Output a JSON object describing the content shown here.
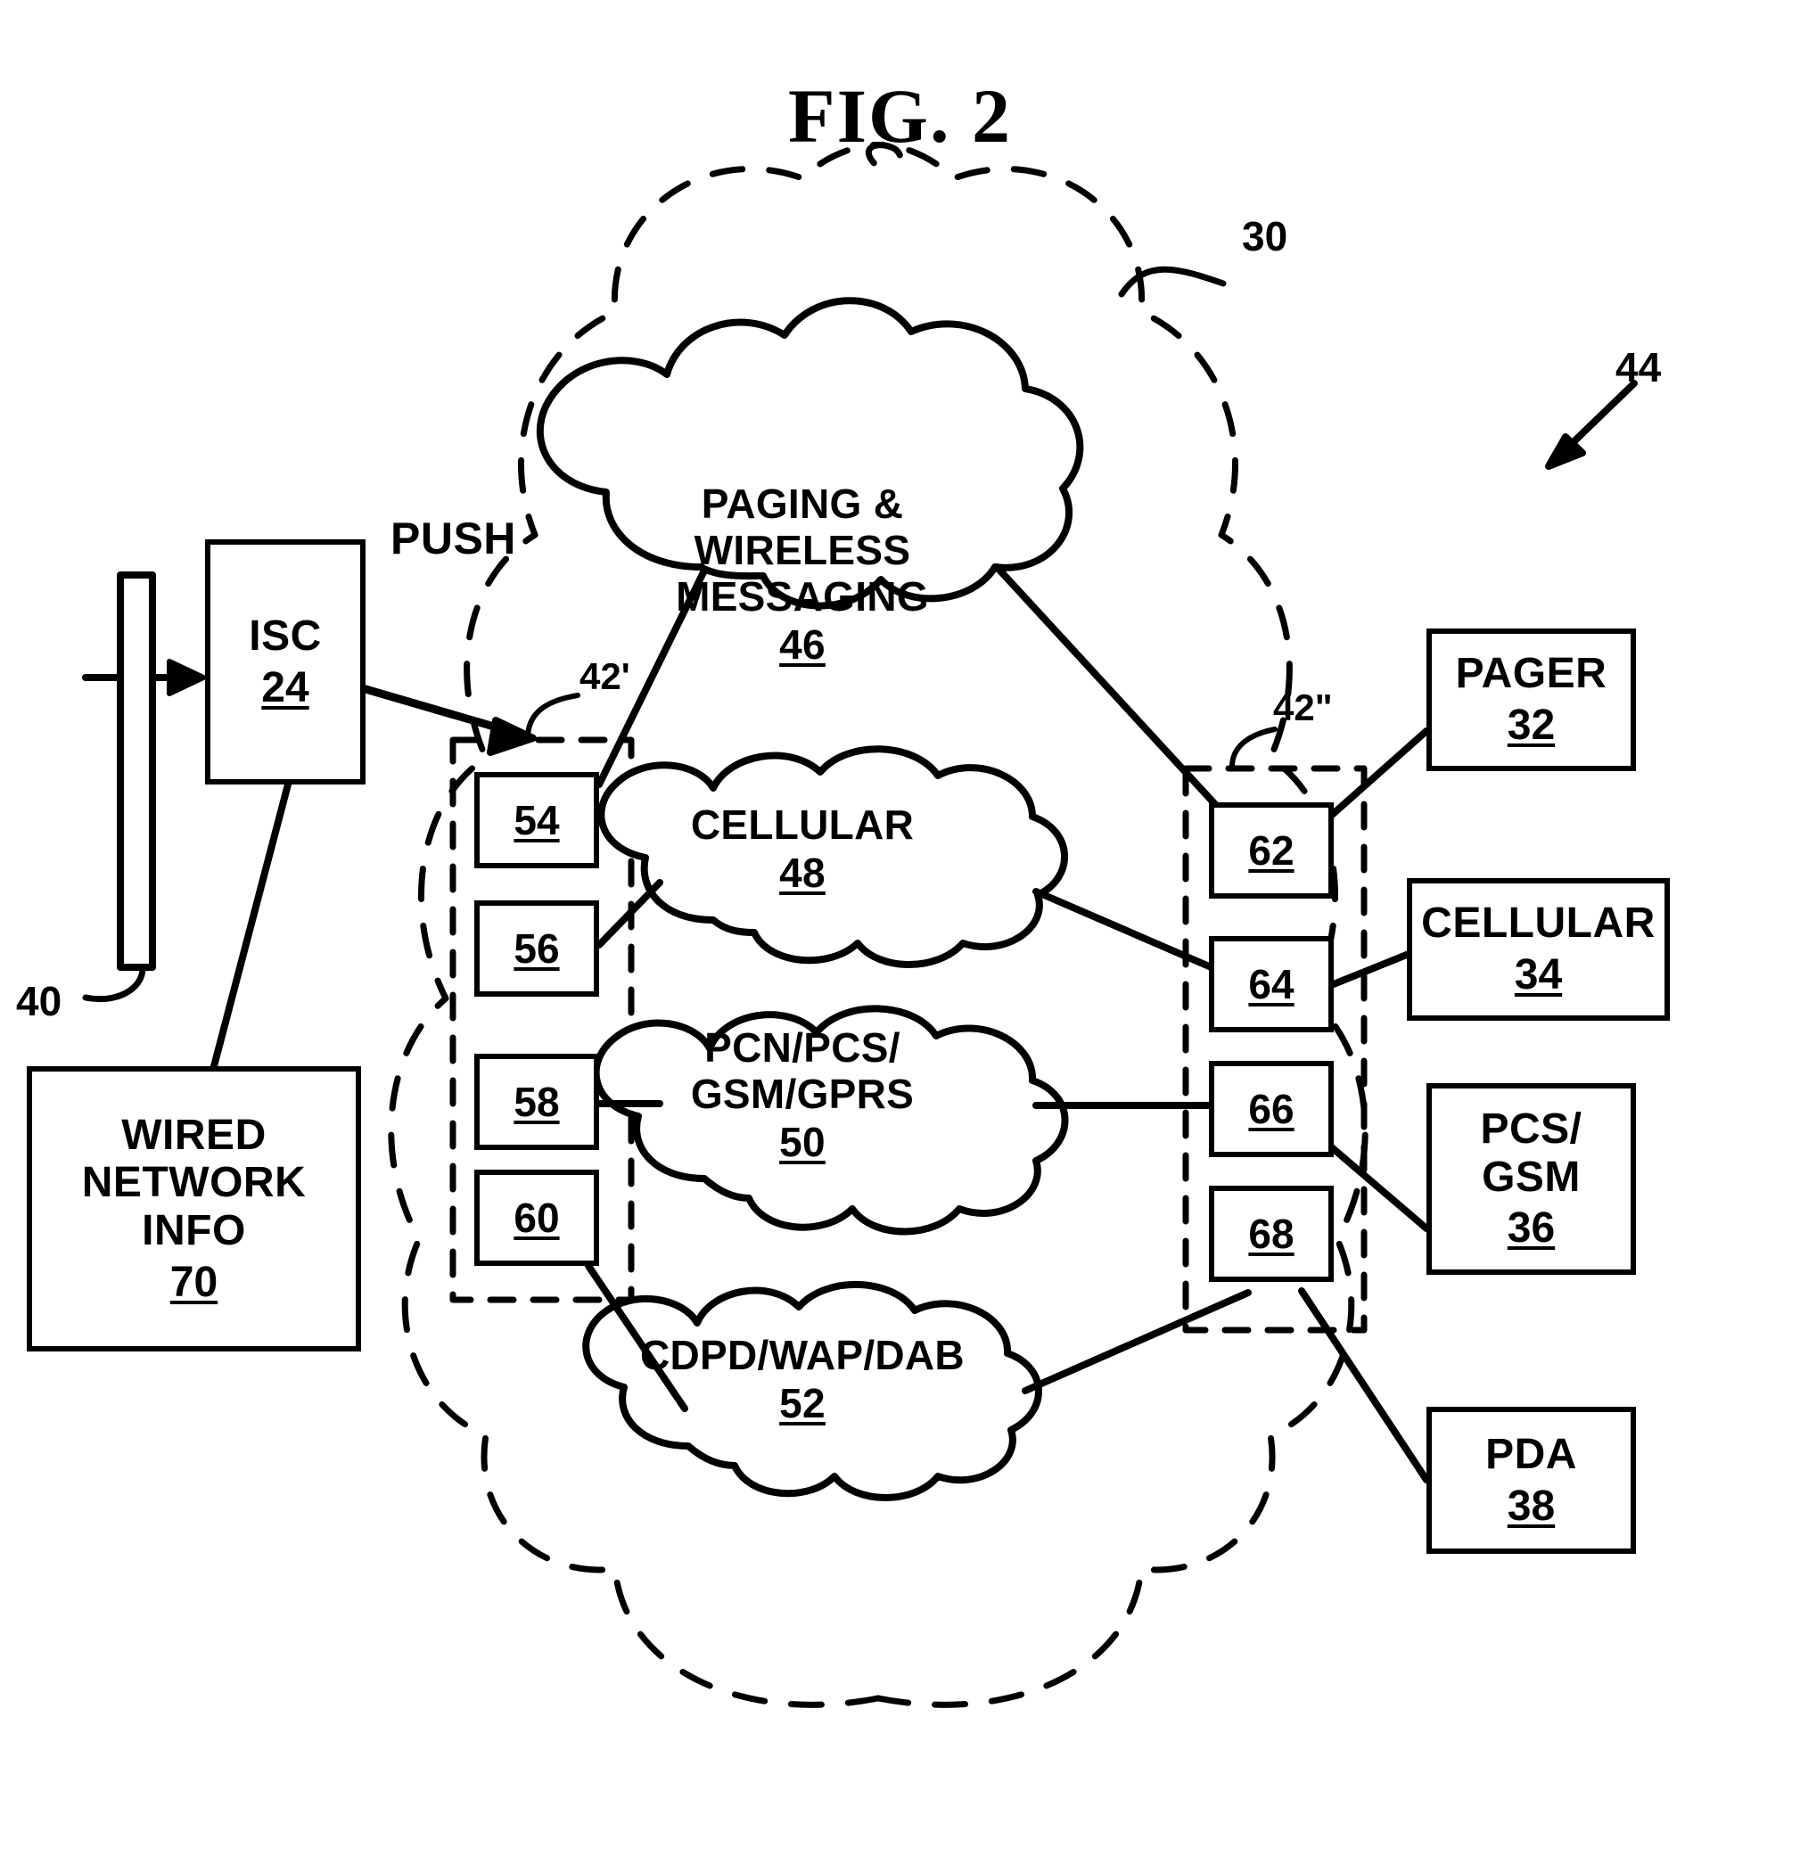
{
  "figure": {
    "title": "FIG. 2"
  },
  "annotations": {
    "push_label": "PUSH"
  },
  "reference_numerals": {
    "outer_cloud": "30",
    "diagram": "44",
    "bus": "40",
    "left_interface_group": "42'",
    "right_interface_group": "42\""
  },
  "source_nodes": [
    {
      "name": "isc",
      "title": "ISC",
      "num": "24"
    },
    {
      "name": "wired-network-info",
      "title": "WIRED\nNETWORK\nINFO",
      "title_lines": [
        "WIRED",
        "NETWORK",
        "INFO"
      ],
      "num": "70"
    }
  ],
  "left_interfaces": [
    {
      "name": "interface-54",
      "num": "54"
    },
    {
      "name": "interface-56",
      "num": "56"
    },
    {
      "name": "interface-58",
      "num": "58"
    },
    {
      "name": "interface-60",
      "num": "60"
    }
  ],
  "networks": [
    {
      "name": "paging-wireless-messaging",
      "lines": [
        "PAGING &",
        "WIRELESS",
        "MESSAGING"
      ],
      "num": "46"
    },
    {
      "name": "cellular-network",
      "lines": [
        "CELLULAR"
      ],
      "num": "48"
    },
    {
      "name": "pcn-pcs-gsm-gprs",
      "lines": [
        "PCN/PCS/",
        "GSM/GPRS"
      ],
      "num": "50"
    },
    {
      "name": "cdpd-wap-dab",
      "lines": [
        "CDPD/WAP/DAB"
      ],
      "num": "52"
    }
  ],
  "right_interfaces": [
    {
      "name": "interface-62",
      "num": "62"
    },
    {
      "name": "interface-64",
      "num": "64"
    },
    {
      "name": "interface-66",
      "num": "66"
    },
    {
      "name": "interface-68",
      "num": "68"
    }
  ],
  "devices": [
    {
      "name": "pager-device",
      "lines": [
        "PAGER"
      ],
      "num": "32"
    },
    {
      "name": "cellular-device",
      "lines": [
        "CELLULAR"
      ],
      "num": "34"
    },
    {
      "name": "pcs-gsm-device",
      "lines": [
        "PCS/",
        "GSM"
      ],
      "num": "36"
    },
    {
      "name": "pda-device",
      "lines": [
        "PDA"
      ],
      "num": "38"
    }
  ],
  "colors": {
    "ink": "#000000",
    "paper": "#ffffff"
  }
}
